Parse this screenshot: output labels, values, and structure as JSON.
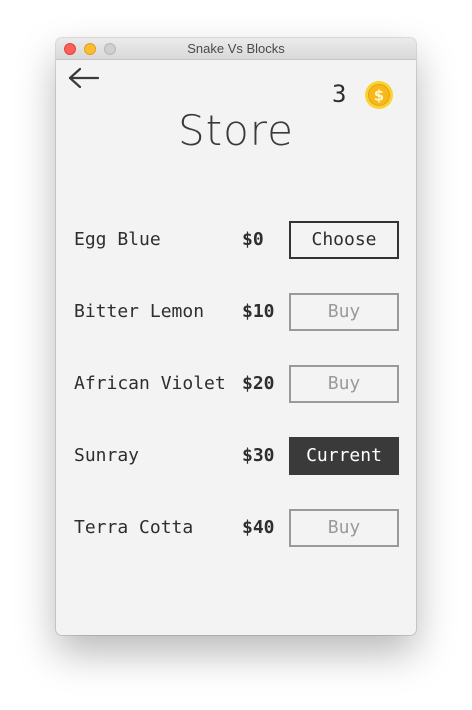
{
  "window": {
    "title": "Snake Vs Blocks"
  },
  "header": {
    "back_icon": "arrow-left-icon",
    "coin_count": "3",
    "coin_icon": "dollar-coin-icon",
    "coin_color": "#f6b81a",
    "title": "Store"
  },
  "store": {
    "items": [
      {
        "name": "Egg Blue",
        "price": "$0",
        "action": "Choose",
        "state": "owned"
      },
      {
        "name": "Bitter Lemon",
        "price": "$10",
        "action": "Buy",
        "state": "locked"
      },
      {
        "name": "African Violet",
        "price": "$20",
        "action": "Buy",
        "state": "locked"
      },
      {
        "name": "Sunray",
        "price": "$30",
        "action": "Current",
        "state": "current"
      },
      {
        "name": "Terra Cotta",
        "price": "$40",
        "action": "Buy",
        "state": "locked"
      }
    ]
  },
  "colors": {
    "background": "#f3f3f3",
    "text": "#2e2e2e",
    "buy_disabled": "#9a9a9a",
    "current_fill": "#3a3a3a"
  }
}
